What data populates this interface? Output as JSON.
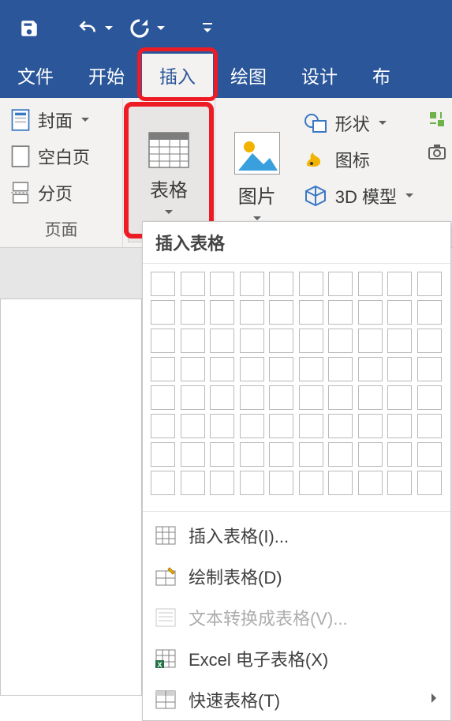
{
  "qat": {
    "save": "save-icon",
    "undo": "undo-icon",
    "redo": "redo-icon"
  },
  "tabs": {
    "file": "文件",
    "home": "开始",
    "insert": "插入",
    "draw": "绘图",
    "design": "设计",
    "layout": "布"
  },
  "ribbon": {
    "pages": {
      "cover": "封面",
      "blank": "空白页",
      "break": "分页",
      "label": "页面"
    },
    "tables": {
      "table": "表格"
    },
    "illustrations": {
      "picture": "图片",
      "shapes": "形状",
      "icons": "图标",
      "model3d": "3D 模型"
    }
  },
  "dropdown": {
    "header": "插入表格",
    "grid_cols": 10,
    "grid_rows": 8,
    "items": {
      "insert": "插入表格(I)...",
      "draw": "绘制表格(D)",
      "convert": "文本转换成表格(V)...",
      "excel": "Excel 电子表格(X)",
      "quick": "快速表格(T)"
    }
  }
}
